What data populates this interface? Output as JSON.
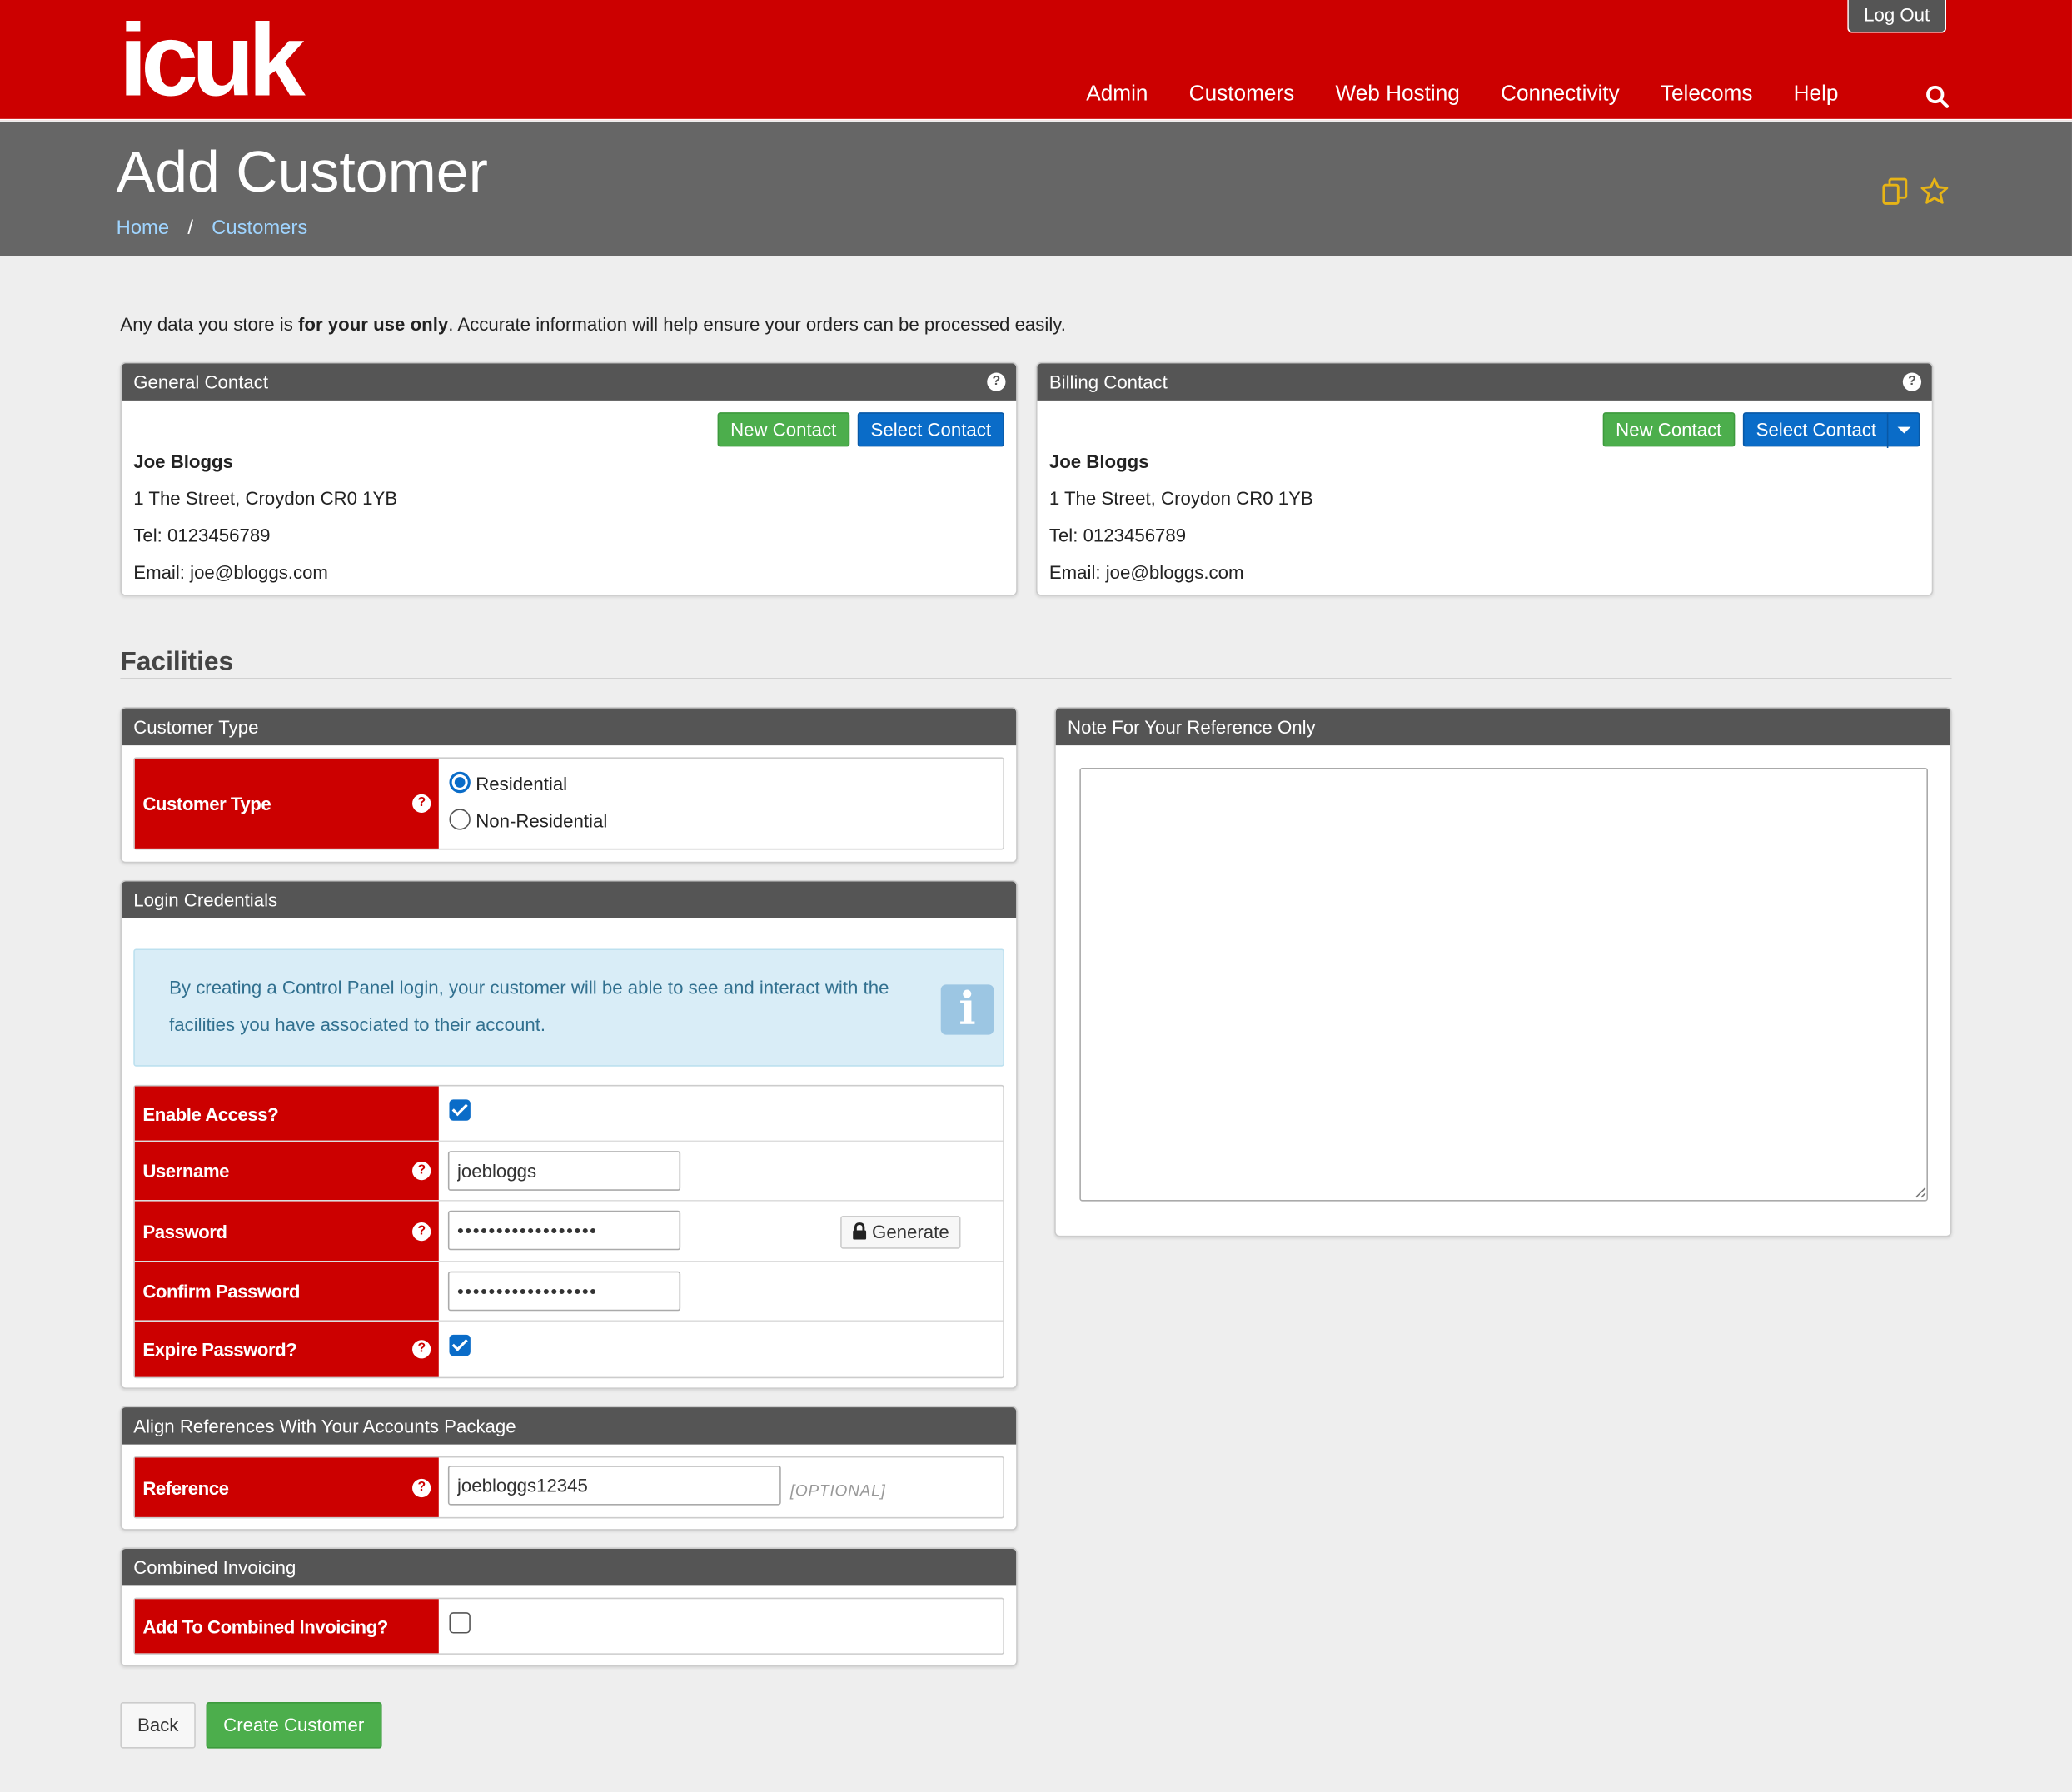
{
  "header": {
    "logo": "icuk",
    "logout_label": "Log Out",
    "nav": [
      "Admin",
      "Customers",
      "Web Hosting",
      "Connectivity",
      "Telecoms",
      "Help"
    ],
    "search_icon": "search-icon"
  },
  "title": {
    "text": "Add Customer",
    "breadcrumb": [
      "Home",
      "Customers"
    ],
    "breadcrumb_sep": "/",
    "icons": [
      "copy-icon",
      "star-icon"
    ]
  },
  "intro": {
    "before": "Any data you store is ",
    "bold": "for your use only",
    "after": ". Accurate information will help ensure your orders can be processed easily."
  },
  "general_contact": {
    "heading": "General Contact",
    "help": "?",
    "new_label": "New Contact",
    "select_label": "Select Contact",
    "name": "Joe Bloggs",
    "address": "1 The Street, Croydon CR0 1YB",
    "tel": "Tel: 0123456789",
    "email": "Email: joe@bloggs.com"
  },
  "billing_contact": {
    "heading": "Billing Contact",
    "help": "?",
    "new_label": "New Contact",
    "select_label": "Select Contact",
    "name": "Joe Bloggs",
    "address": "1 The Street, Croydon CR0 1YB",
    "tel": "Tel: 0123456789",
    "email": "Email: joe@bloggs.com"
  },
  "facilities": {
    "title": "Facilities"
  },
  "customer_type": {
    "heading": "Customer Type",
    "label": "Customer Type",
    "help": "?",
    "options": [
      "Residential",
      "Non-Residential"
    ],
    "selected": "Residential"
  },
  "login": {
    "heading": "Login Credentials",
    "info": "By creating a Control Panel login, your customer will be able to see and interact with the facilities you have associated to their account.",
    "enable_label": "Enable Access?",
    "enable_checked": true,
    "username_label": "Username",
    "username_value": "joebloggs",
    "password_label": "Password",
    "password_value": "••••••••••••••••••",
    "generate_label": "Generate",
    "confirm_label": "Confirm Password",
    "confirm_value": "••••••••••••••••••",
    "expire_label": "Expire Password?",
    "expire_checked": true,
    "help": "?"
  },
  "references": {
    "heading": "Align References With Your Accounts Package",
    "label": "Reference",
    "help": "?",
    "value": "joebloggs12345",
    "optional": "[OPTIONAL]"
  },
  "combined": {
    "heading": "Combined Invoicing",
    "label": "Add To Combined Invoicing?",
    "checked": false
  },
  "note": {
    "heading": "Note For Your Reference Only",
    "value": ""
  },
  "actions": {
    "back_label": "Back",
    "create_label": "Create Customer"
  },
  "colors": {
    "brand_red": "#cc0000",
    "title_band": "#666666",
    "panel_head": "#555555",
    "primary_blue": "#0a6cc8",
    "success_green": "#4cae4c",
    "info_bg": "#d9edf7"
  }
}
